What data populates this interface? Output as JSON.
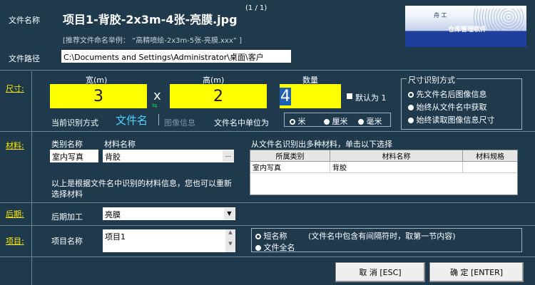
{
  "header": {
    "file_name_label": "文件名称",
    "file_name_value": "项目1-背胶-2x3m-4张-亮膜.jpg",
    "page_indicator": "(1 / 1)",
    "hint": "[推荐文件命名举例： “高精喷绘-2x3m-5张-亮膜.xxx” ]",
    "file_path_label": "文件路径",
    "file_path_value": "C:\\Documents and Settings\\Administrator\\桌面\\客户",
    "logo_text": "仓库管理软件",
    "logo_small": "舟 工"
  },
  "size": {
    "section_label": "尺寸:",
    "width_label": "宽(m)",
    "width_value": "3",
    "times": "x",
    "height_label": "高(m)",
    "height_value": "2",
    "qty_label": "数量",
    "qty_value": "4",
    "default_one": "默认为 1",
    "current_mode_label": "当前识别方式",
    "current_mode_value": "文件名",
    "image_info": "图像信息",
    "unit_label": "文件名中单位为",
    "units": [
      "米",
      "厘米",
      "毫米"
    ],
    "unit_selected": 0,
    "recog_title": "尺寸识别方式",
    "recog_options": [
      "先文件名后图像信息",
      "始终从文件名中获取",
      "始终读取图像信息尺寸"
    ],
    "recog_selected": 0
  },
  "material": {
    "section_label": "材料:",
    "category_label": "类别名称",
    "category_value": "室内写真",
    "name_label": "材料名称",
    "name_value": "背胶",
    "browse": "...",
    "note": "以上是根据文件名中识别的材料信息，您也可以重新选择材料",
    "multi_title": "从文件名识别出多种材料，单击以下选择",
    "columns": [
      "所属类别",
      "材料名称",
      "材料规格"
    ],
    "rows": [
      [
        "室内写真",
        "背胶",
        ""
      ]
    ]
  },
  "post": {
    "section_label": "后期:",
    "label": "后期加工",
    "value": "亮膜"
  },
  "project": {
    "section_label": "项目:",
    "label": "项目名称",
    "value": "项目1",
    "opt_short": "短名称",
    "opt_short_note": "(文件名中包含有间隔符时，取第一节内容)",
    "opt_full": "文件全名"
  },
  "buttons": {
    "cancel": "取 消 [ESC]",
    "ok": "确 定 [ENTER]"
  }
}
